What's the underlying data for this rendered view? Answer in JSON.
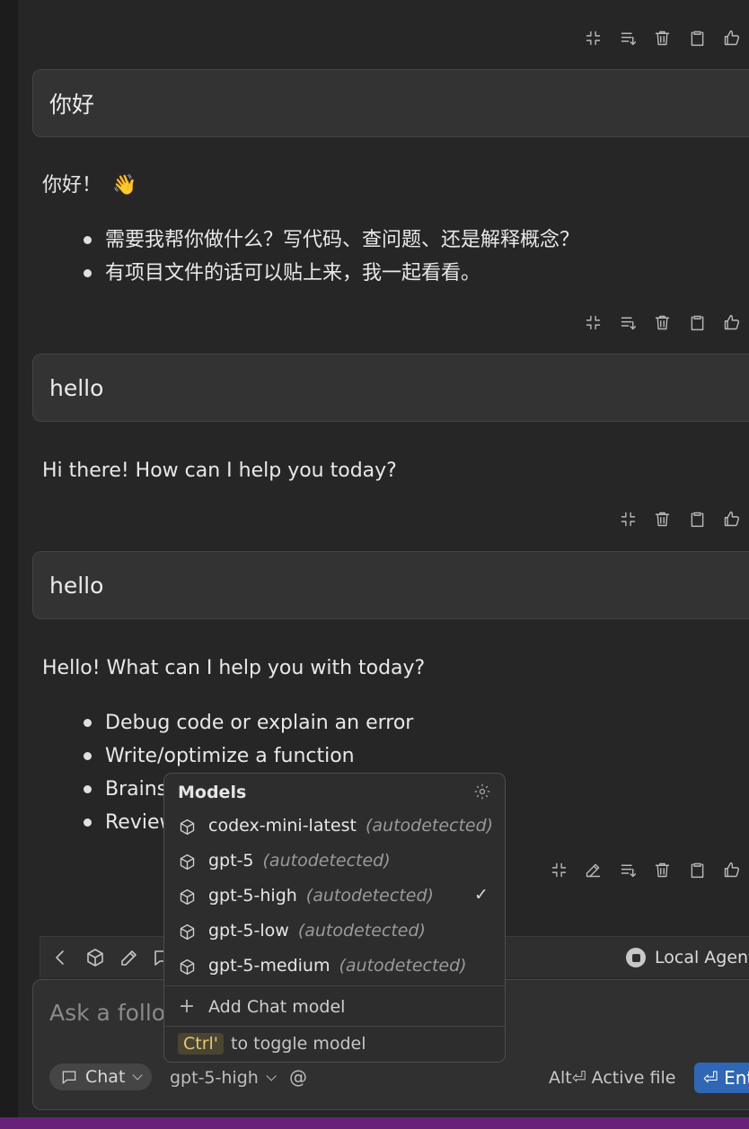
{
  "conversation": {
    "user_messages": [
      "你好",
      "hello",
      "hello"
    ],
    "responses": [
      {
        "text": "你好！",
        "emoji": "👋",
        "bullets": [
          "需要我帮你做什么？写代码、查问题、还是解释概念？",
          "有项目文件的话可以贴上来，我一起看看。"
        ]
      },
      {
        "text": "Hi there! How can I help you today?"
      },
      {
        "text": "Hello! What can I help you with today?",
        "bullets": [
          "Debug code or explain an error",
          "Write/optimize a function",
          "Brains",
          "Review"
        ]
      }
    ]
  },
  "message_toolbar_icons": [
    "collapse-icon",
    "edit-icon",
    "apply-icon",
    "trash-icon",
    "clipboard-icon",
    "thumbs-up-icon"
  ],
  "models_popup": {
    "title": "Models",
    "items": [
      {
        "name": "codex-mini-latest",
        "tag": "(autodetected)",
        "selected": false
      },
      {
        "name": "gpt-5",
        "tag": "(autodetected)",
        "selected": false
      },
      {
        "name": "gpt-5-high",
        "tag": "(autodetected)",
        "selected": true
      },
      {
        "name": "gpt-5-low",
        "tag": "(autodetected)",
        "selected": false
      },
      {
        "name": "gpt-5-medium",
        "tag": "(autodetected)",
        "selected": false
      }
    ],
    "check_mark": "✓",
    "add_label": "Add Chat model",
    "hint_key": "Ctrl'",
    "hint_text": "to toggle model"
  },
  "input_toolbar": {
    "agent_label": "Local Agent"
  },
  "input": {
    "placeholder": "Ask a follo",
    "mode_label": "Chat",
    "model_label": "gpt-5-high",
    "at_label": "@",
    "alt_hint": "Alt⏎ Active file",
    "enter_label": "⏎ Ent"
  },
  "colors": {
    "background": "#262626",
    "accent": "#2f67b6",
    "status_bar": "#68217a"
  }
}
